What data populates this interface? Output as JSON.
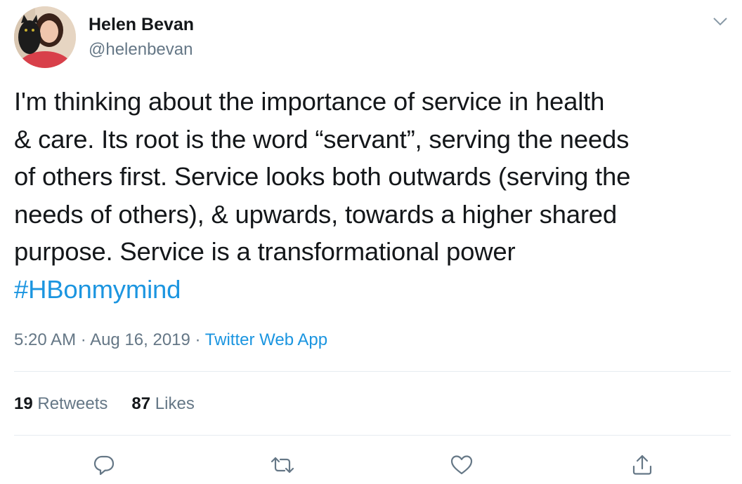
{
  "author": {
    "name": "Helen Bevan",
    "handle": "@helenbevan"
  },
  "tweet": {
    "text_lines": [
      "I'm thinking about the importance of service in health",
      "& care. Its root is the word “servant”, serving the needs",
      "of others first. Service looks both outwards (serving the",
      "needs of others), & upwards, towards a higher shared",
      "purpose. Service is a transformational power"
    ],
    "hashtag": "#HBonmymind"
  },
  "meta": {
    "time": "5:20 AM",
    "separator": "·",
    "date": "Aug 16, 2019",
    "source": "Twitter Web App"
  },
  "stats": {
    "retweets_count": "19",
    "retweets_label": "Retweets",
    "likes_count": "87",
    "likes_label": "Likes"
  },
  "icons": {
    "caret": "chevron-down-icon",
    "reply": "reply-icon",
    "retweet": "retweet-icon",
    "like": "heart-icon",
    "share": "share-icon"
  },
  "colors": {
    "text": "#14171a",
    "secondary": "#657786",
    "link": "#1b95e0",
    "divider": "#e6ecf0"
  }
}
